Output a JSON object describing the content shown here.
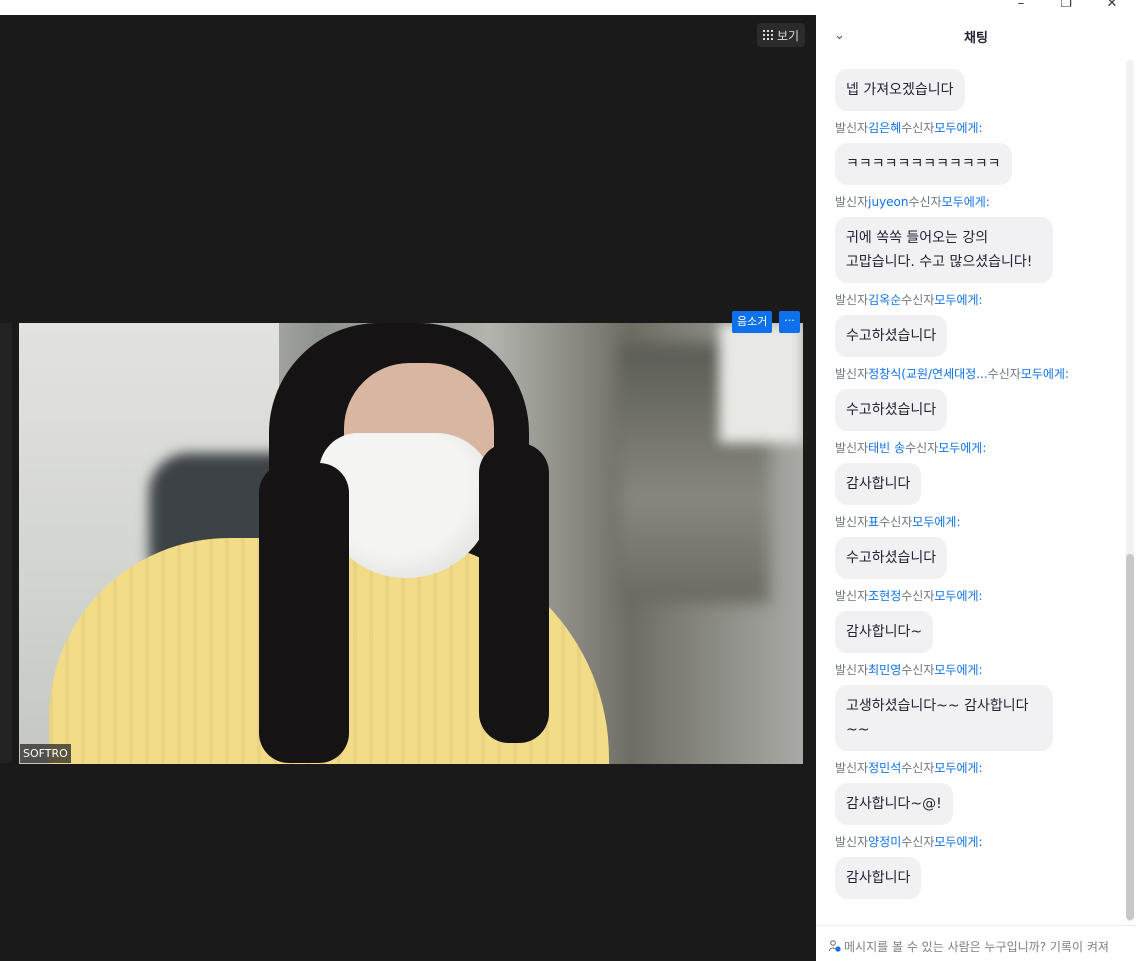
{
  "window": {
    "minimize": "–",
    "restore": "❐",
    "close": "✕"
  },
  "video": {
    "view_button_label": "보기",
    "mute_label": "음소거",
    "more_label": "···",
    "participant_name": "SOFTRO"
  },
  "chat": {
    "collapse_icon": "⌄",
    "title": "채팅",
    "from_label": "발신자",
    "to_label": "수신자",
    "to_target": "모두에게:",
    "first_message": "넵 가져오겠습니다",
    "messages": [
      {
        "sender": "김은혜",
        "text": "ㅋㅋㅋㅋㅋㅋㅋㅋㅋㅋㅋㅋ"
      },
      {
        "sender": "juyeon",
        "text": "귀에 쏙쏙 들어오는 강의 고맙습니다. 수고 많으셨습니다!"
      },
      {
        "sender": "김옥순",
        "text": "수고하셨습니다"
      },
      {
        "sender": "정창식(교원/연세대정...",
        "text": "수고하셨습니다"
      },
      {
        "sender": "태빈 송",
        "text": "감사합니다"
      },
      {
        "sender": "표",
        "text": "수고하셨습니다"
      },
      {
        "sender": "조현정",
        "text": "감사합니다~"
      },
      {
        "sender": "최민영",
        "text": "고생하셨습니다~~ 감사합니다~~"
      },
      {
        "sender": "정민석",
        "text": "감사합니다~@!"
      },
      {
        "sender": "양정미",
        "text": "감사합니다"
      }
    ],
    "footer_text": "메시지를 볼 수 있는 사람은 누구입니까? 기록이 켜져"
  }
}
